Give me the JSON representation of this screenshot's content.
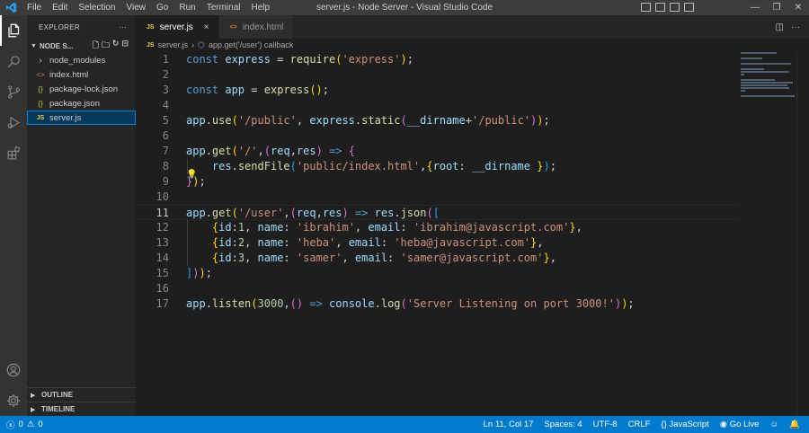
{
  "titlebar": {
    "menu": [
      "File",
      "Edit",
      "Selection",
      "View",
      "Go",
      "Run",
      "Terminal",
      "Help"
    ],
    "window_title": "server.js - Node Server - Visual Studio Code"
  },
  "sidebar": {
    "header": "EXPLORER",
    "more": "···",
    "folder": "NODE S...",
    "items": [
      {
        "label": "node_modules",
        "icon": "›",
        "type": "folder"
      },
      {
        "label": "index.html",
        "icon": "<>",
        "type": "html"
      },
      {
        "label": "package-lock.json",
        "icon": "{}",
        "type": "json"
      },
      {
        "label": "package.json",
        "icon": "{}",
        "type": "json"
      },
      {
        "label": "server.js",
        "icon": "JS",
        "type": "js"
      }
    ],
    "outline": "OUTLINE",
    "timeline": "TIMELINE"
  },
  "tabs": [
    {
      "label": "server.js",
      "icon": "JS",
      "close": "×"
    },
    {
      "label": "index.html",
      "icon": "<>"
    }
  ],
  "breadcrumb": {
    "file": "server.js",
    "file_icon": "JS",
    "symbol": "app.get('/user') callback"
  },
  "line_numbers": [
    "1",
    "2",
    "3",
    "4",
    "5",
    "6",
    "7",
    "8",
    "9",
    "10",
    "11",
    "12",
    "13",
    "14",
    "15",
    "16",
    "17"
  ],
  "code_lines": [
    "const express = require('express');",
    "",
    "const app = express();",
    "",
    "app.use('/public', express.static(__dirname+'/public'));",
    "",
    "app.get('/',(req,res) => {",
    "    res.sendFile('public/index.html',{root: __dirname });",
    "});",
    "",
    "app.get('/user',(req,res) => res.json([",
    "    {id:1, name: 'ibrahim', email: 'ibrahim@javascript.com'},",
    "    {id:2, name: 'heba', email: 'heba@javascript.com'},",
    "    {id:3, name: 'samer', email: 'samer@javascript.com'},",
    "]));",
    "",
    "app.listen(3000,() => console.log('Server Listening on port 3000!'));"
  ],
  "current_line": 11,
  "statusbar": {
    "errors": "0",
    "warnings": "0",
    "position": "Ln 11, Col 17",
    "spaces": "Spaces: 4",
    "encoding": "UTF-8",
    "eol": "CRLF",
    "language": "JavaScript",
    "golive": "Go Live"
  },
  "colors": {
    "accent": "#007acc",
    "editor_bg": "#1e1e1e",
    "sidebar_bg": "#252526",
    "activity_bg": "#333333",
    "titlebar_bg": "#3c3c3c"
  }
}
